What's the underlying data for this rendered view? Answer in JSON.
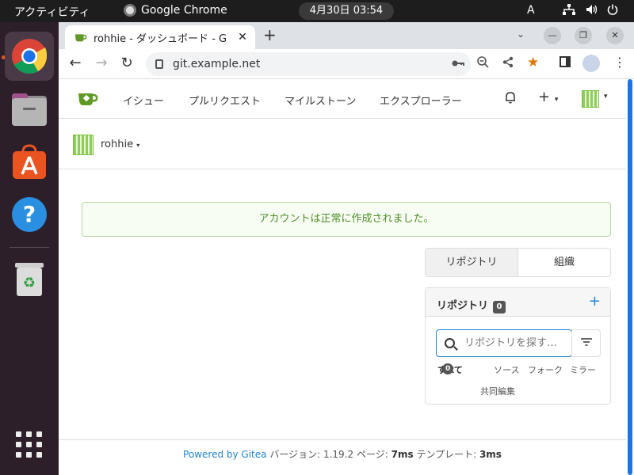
{
  "system": {
    "activities": "アクティビティ",
    "app_name": "Google Chrome",
    "clock": "4月30日  03:54",
    "ime": "A",
    "icons": [
      "network-icon",
      "volume-icon",
      "power-icon"
    ]
  },
  "dock": {
    "items": [
      "chrome",
      "files",
      "app-center",
      "help",
      "trash",
      "show-apps"
    ]
  },
  "browser": {
    "tab_title": "rohhie - ダッシュボード - G",
    "url": "git.example.net",
    "window_controls": [
      "minimize",
      "maximize",
      "close"
    ]
  },
  "gitea": {
    "nav": {
      "issues": "イシュー",
      "pulls": "プルリクエスト",
      "milestones": "マイルストーン",
      "explore": "エクスプローラー"
    },
    "context_user": "rohhie",
    "flash_message": "アカウントは正常に作成されました。",
    "tabs": {
      "repos": "リポジトリ",
      "orgs": "組織"
    },
    "repo_panel": {
      "title": "リポジトリ",
      "count": "0",
      "search_placeholder": "リポジトリを探す…",
      "filters": {
        "all": "すべて",
        "all_count": "0",
        "sources": "ソース",
        "forks": "フォーク",
        "mirrors": "ミラー",
        "collab": "共同編集"
      }
    },
    "footer": {
      "powered": "Powered by Gitea",
      "version_label": "バージョン:",
      "version": "1.19.2",
      "page_label": "ページ:",
      "page_time": "7ms",
      "template_label": "テンプレート:",
      "template_time": "3ms"
    }
  },
  "colors": {
    "accent": "#2185d0",
    "gitea_green": "#609926",
    "flash_bg": "#f8fdf3",
    "dock_bg": "#2c1f2a"
  }
}
